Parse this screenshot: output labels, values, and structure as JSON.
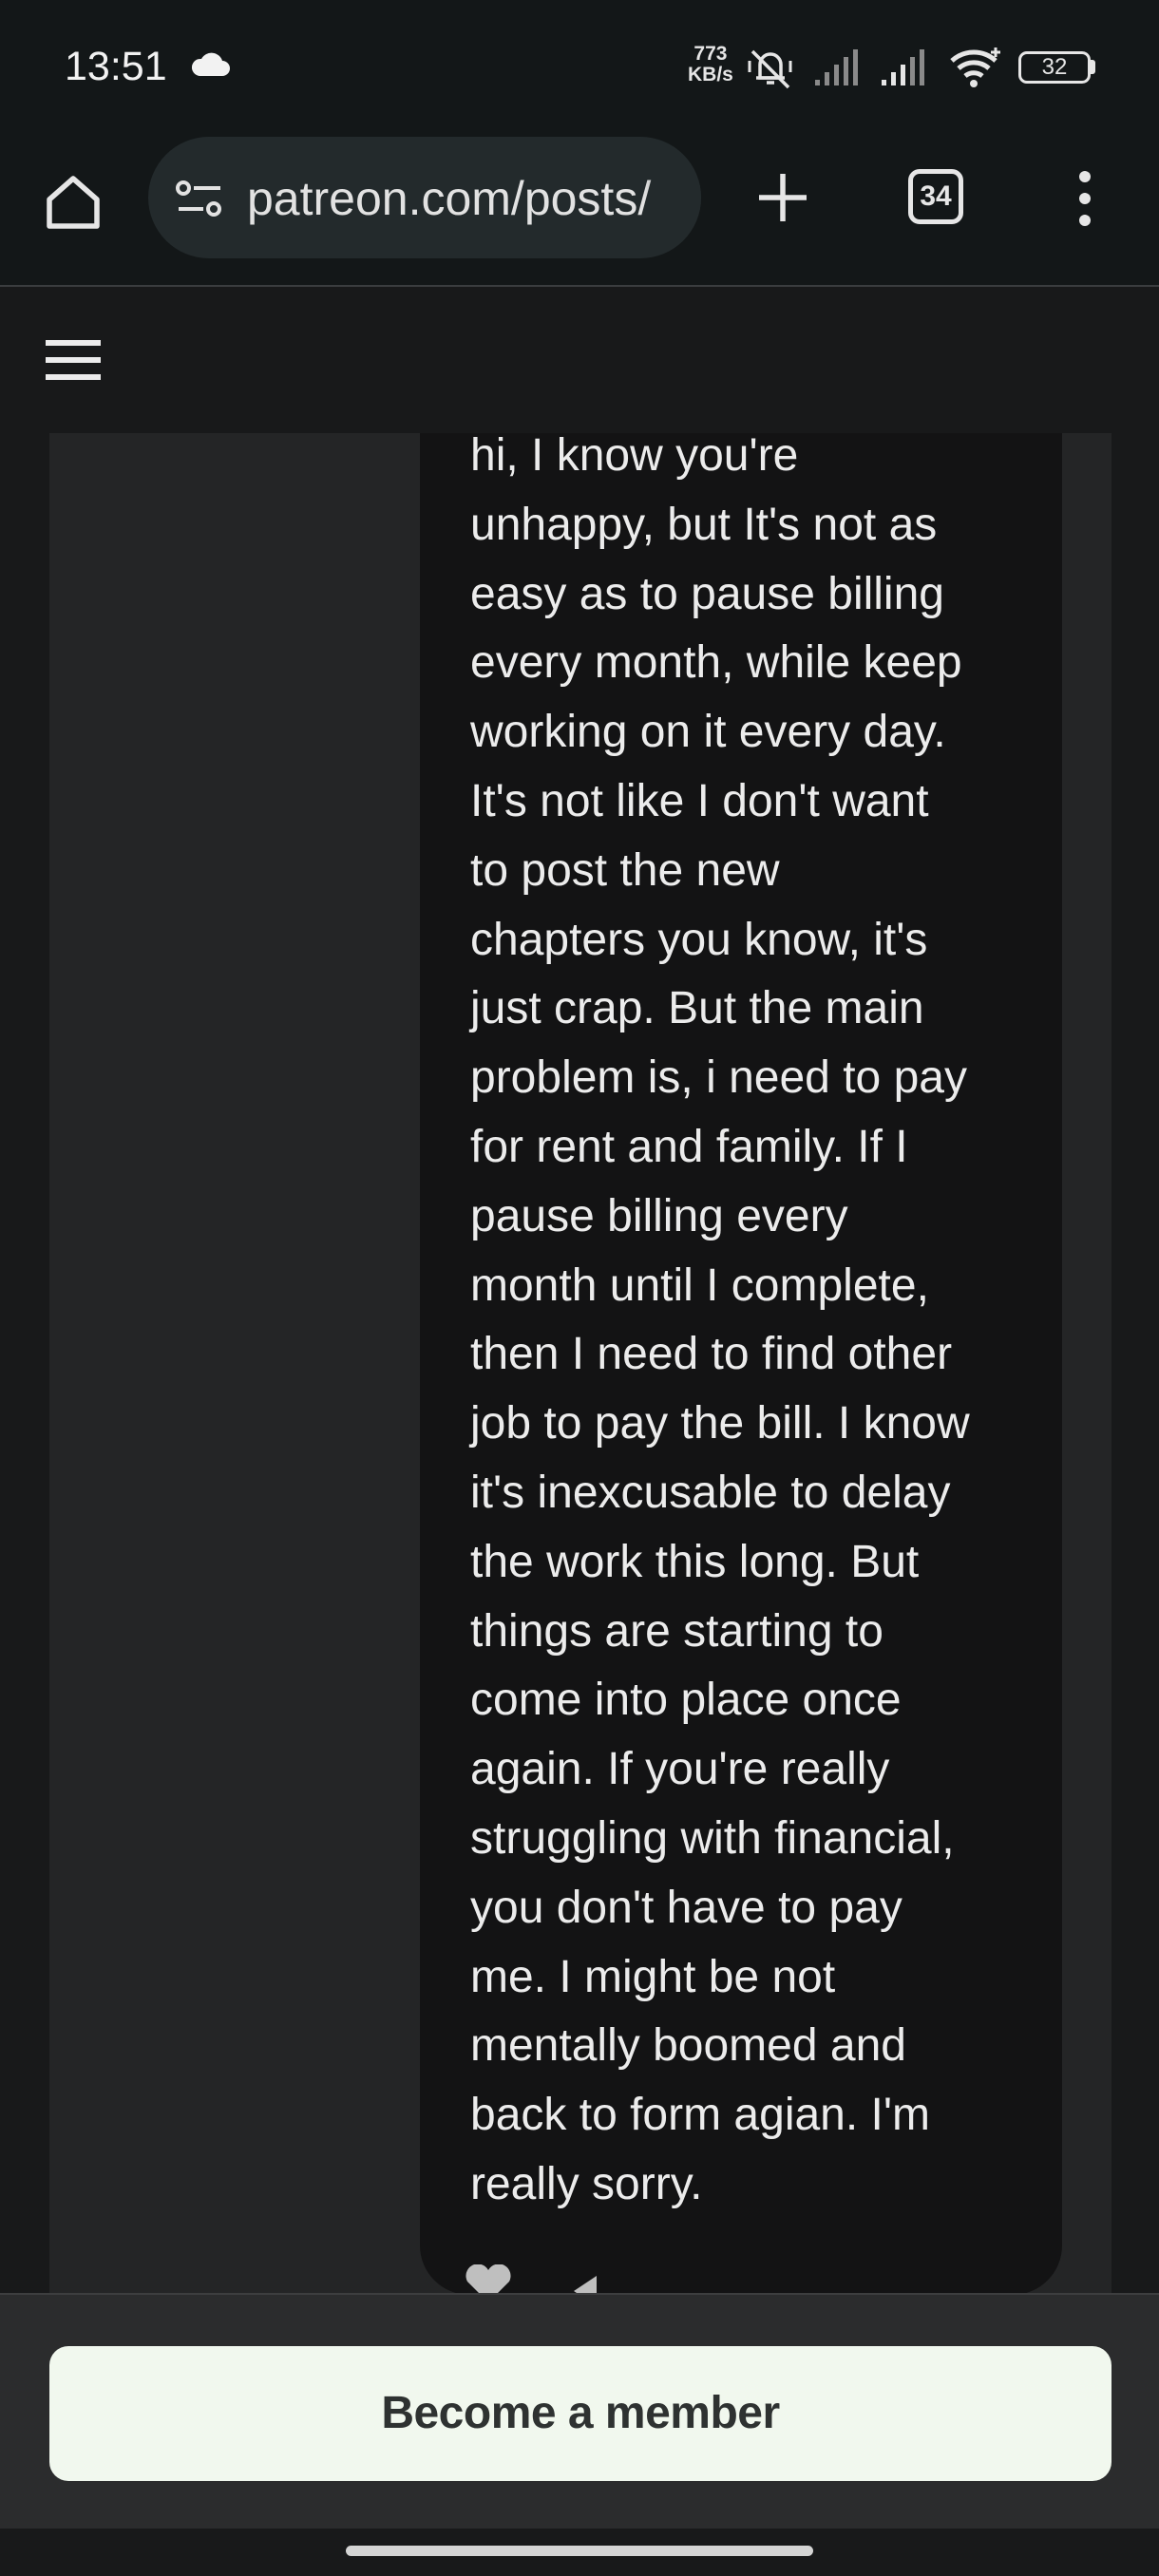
{
  "status_bar": {
    "time": "13:51",
    "net_speed_value": "773",
    "net_speed_unit": "KB/s",
    "battery": "32",
    "icons": [
      "cloud-icon",
      "mute-vibrate-icon",
      "signal-1-icon",
      "signal-2-icon",
      "wifi-icon",
      "battery-icon"
    ]
  },
  "browser": {
    "url": "patreon.com/posts/",
    "tab_count": "34",
    "icons": [
      "home-icon",
      "site-settings-icon",
      "new-tab-icon",
      "tabs-icon",
      "more-menu-icon"
    ]
  },
  "page": {
    "menu_icon": "hamburger-icon",
    "comment_text": "hi, I know you're\nunhappy, but It's not as\neasy as to pause billing\nevery month, while keep\nworking on it every day.\nIt's not like I don't want\nto post the new\nchapters you know, it's\njust crap. But the main\nproblem is, i need to pay\nfor rent and family. If I\npause billing every\nmonth until I complete,\nthen I need to find other\njob to pay the bill. I know\nit's inexcusable to delay\nthe work this long. But\nthings are starting to\ncome into place once\nagain. If you're really\nstruggling with financial,\nyou don't have to pay\nme.  I might be not\nmentally boomed and\nback to form agian. I'm\nreally sorry.",
    "reaction_icons": [
      "heart-icon",
      "reply-icon"
    ]
  },
  "footer": {
    "cta_label": "Become a member"
  },
  "colors": {
    "background": "#18191a",
    "panel": "#242526",
    "bubble": "#131314",
    "cta": "#f1f8ee"
  }
}
